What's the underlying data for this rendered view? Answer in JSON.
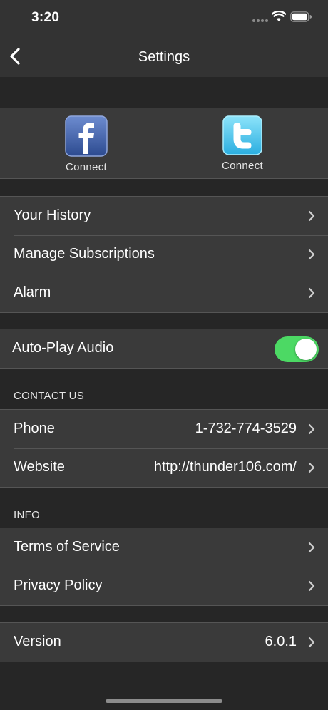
{
  "status_bar": {
    "time": "3:20"
  },
  "nav": {
    "title": "Settings",
    "back_icon": "chevron-left-icon"
  },
  "social": {
    "facebook": {
      "icon": "facebook-logo-icon",
      "label": "Connect",
      "color": "#3b5998"
    },
    "twitter": {
      "icon": "twitter-logo-icon",
      "label": "Connect",
      "color": "#33ccff"
    }
  },
  "account_items": [
    {
      "label": "Your History"
    },
    {
      "label": "Manage Subscriptions"
    },
    {
      "label": "Alarm"
    }
  ],
  "auto_play": {
    "label": "Auto-Play Audio",
    "enabled": true,
    "toggle_color": "#4cd964"
  },
  "contact": {
    "header": "CONTACT US",
    "items": [
      {
        "label": "Phone",
        "value": "1-732-774-3529"
      },
      {
        "label": "Website",
        "value": "http://thunder106.com/"
      }
    ]
  },
  "info": {
    "header": "INFO",
    "items": [
      {
        "label": "Terms of Service"
      },
      {
        "label": "Privacy Policy"
      }
    ]
  },
  "version": {
    "label": "Version",
    "value": "6.0.1"
  }
}
